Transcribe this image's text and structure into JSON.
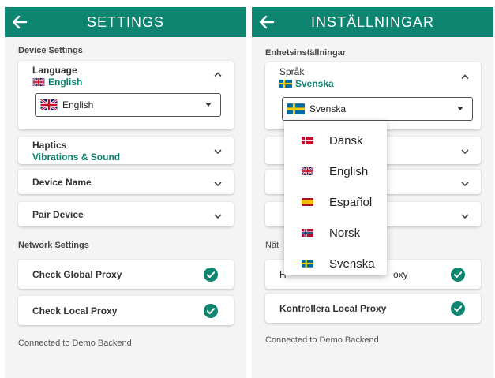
{
  "colors": {
    "primary": "#0d8570",
    "background": "#f4f4f4",
    "card": "#ffffff"
  },
  "left": {
    "title": "SETTINGS",
    "device_section": "Device Settings",
    "language": {
      "label": "Language",
      "value": "English",
      "dropdown_value": "English"
    },
    "haptics": {
      "label": "Haptics",
      "value": "Vibrations & Sound"
    },
    "device_name": {
      "label": "Device Name"
    },
    "pair_device": {
      "label": "Pair Device"
    },
    "network_section": "Network Settings",
    "global_proxy": {
      "label": "Check Global Proxy"
    },
    "local_proxy": {
      "label": "Check Local Proxy"
    },
    "footer": "Connected to Demo Backend"
  },
  "right": {
    "title": "INSTÄLLNINGAR",
    "device_section": "Enhetsinställningar",
    "language": {
      "label": "Språk",
      "value": "Svenska",
      "dropdown_value": "Svenska"
    },
    "network_section_partial": "Nät",
    "global_proxy_partial_left": "H",
    "global_proxy_partial_right": "oxy",
    "local_proxy": {
      "label": "Kontrollera Local Proxy"
    },
    "footer": "Connected to Demo Backend",
    "menu": {
      "items": [
        {
          "label": "Dansk",
          "flag": "denmark-flag"
        },
        {
          "label": "English",
          "flag": "uk-flag"
        },
        {
          "label": "Español",
          "flag": "spain-flag"
        },
        {
          "label": "Norsk",
          "flag": "norway-flag"
        },
        {
          "label": "Svenska",
          "flag": "sweden-flag"
        }
      ]
    }
  },
  "icons": {
    "back": "arrow-left-icon",
    "expand": "chevron-down-icon",
    "collapse": "chevron-up-icon",
    "check": "check-circle-icon",
    "caret": "caret-down-icon"
  }
}
